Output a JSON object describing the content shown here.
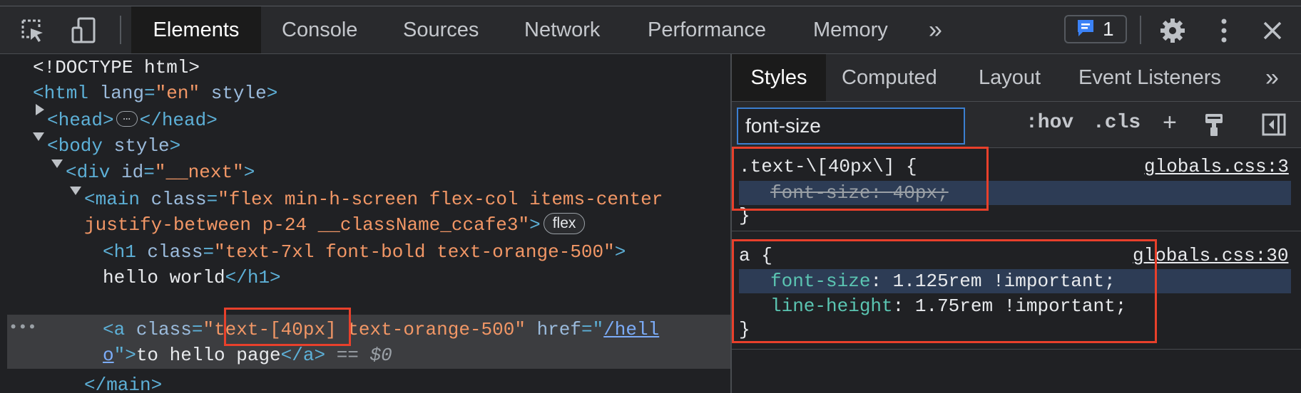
{
  "toolbar": {
    "tabs": [
      "Elements",
      "Console",
      "Sources",
      "Network",
      "Performance",
      "Memory"
    ],
    "overflow": "»",
    "badge_count": "1"
  },
  "elements": {
    "doctype": "<!DOCTYPE html>",
    "html_open": "<html",
    "html_attr": "lang",
    "html_attr_val": "\"en\"",
    "html_style": "style",
    "html_close": ">",
    "head_open": "<head>",
    "head_close": "</head>",
    "body_open": "<body",
    "body_style": "style",
    "body_close": ">",
    "div_open": "<div",
    "div_attr": "id",
    "div_attr_val": "\"__next\"",
    "div_close": ">",
    "main_open": "<main",
    "main_attr": "class",
    "main_val_1": "\"flex min-h-screen flex-col items-center",
    "main_val_2": "justify-between p-24 __className_ccafe3\"",
    "main_close": ">",
    "flex_badge": "flex",
    "h1_open": "<h1",
    "h1_attr": "class",
    "h1_val": "\"text-7xl font-bold text-orange-500\"",
    "h1_close": ">",
    "h1_text": "hello world",
    "h1_end": "</h1>",
    "a_open": "<a",
    "a_attr": "class",
    "a_val_q": "\"",
    "a_val_1": "text-[40px]",
    "a_val_2": " text-orange-500\"",
    "a_href": "href",
    "a_href_eq": "=\"",
    "a_href_link_1": "/hell",
    "a_href_link_2": "o",
    "a_href_end": "\">",
    "a_text": "to hello page",
    "a_end": "</a>",
    "a_eq": "==",
    "a_var": "$0",
    "main_end": "</main>",
    "row_dots": "•••"
  },
  "styles_panel": {
    "tabs": [
      "Styles",
      "Computed",
      "Layout",
      "Event Listeners"
    ],
    "overflow": "»",
    "filter_value": "font-size",
    "hov": ":hov",
    "cls": ".cls",
    "plus": "+",
    "rule1": {
      "selector": ".text-\\[40px\\] {",
      "source": "globals.css:3",
      "prop": "font-size",
      "value": "40px;",
      "close": "}"
    },
    "rule2": {
      "selector": "a {",
      "source": "globals.css:30",
      "prop1": "font-size",
      "value1": "1.125rem !important;",
      "prop2": "line-height",
      "value2": "1.75rem !important;",
      "close": "}"
    }
  },
  "colors": {
    "accent_red": "#e8402b",
    "active_blue": "#3b7fd0",
    "badge_blue": "#3b82f6"
  }
}
